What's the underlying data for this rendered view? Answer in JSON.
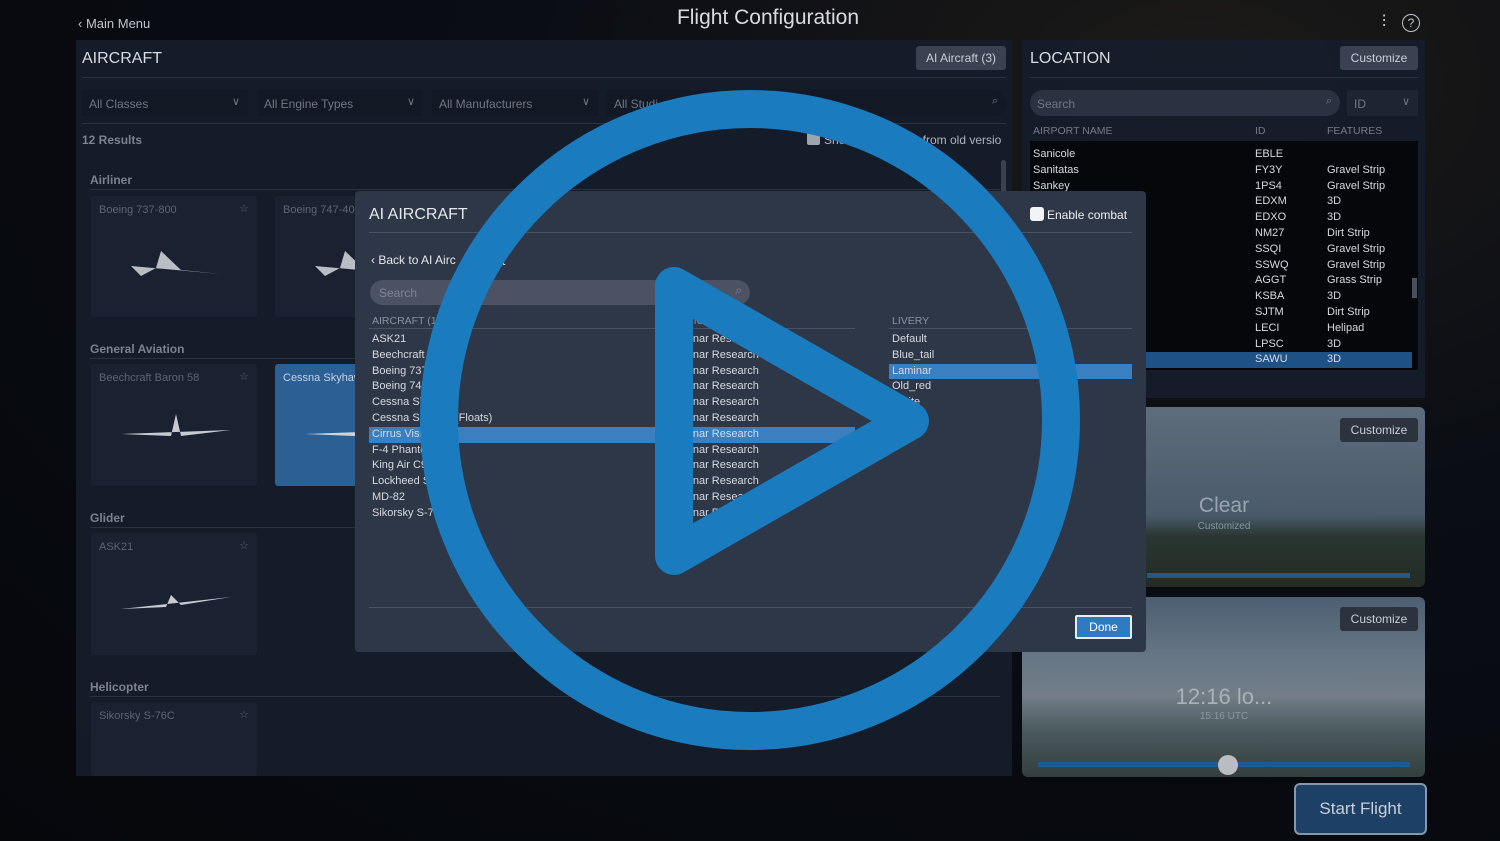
{
  "header": {
    "title": "Flight Configuration",
    "back_label": "Main Menu",
    "icons": [
      "sliders-icon",
      "help-icon"
    ]
  },
  "aircraft": {
    "title": "AIRCRAFT",
    "ai_button": "AI Aircraft (3)",
    "filters": [
      "All Classes",
      "All Engine Types",
      "All Manufacturers",
      "All Studi"
    ],
    "results": "12 Results",
    "show_old_label": "Show",
    "show_old_suffix": "t from old versio",
    "sections": [
      {
        "label": "Airliner",
        "cards": [
          "Boeing 737-800",
          "Boeing 747-400"
        ]
      },
      {
        "label": "General Aviation",
        "cards": [
          "Beechcraft Baron 58",
          "Cessna Skyhaw"
        ]
      },
      {
        "label": "Glider",
        "cards": [
          "ASK21"
        ]
      },
      {
        "label": "Helicopter",
        "cards": [
          "Sikorsky S-76C"
        ]
      }
    ]
  },
  "location": {
    "title": "LOCATION",
    "customize": "Customize",
    "search_placeholder": "Search",
    "id_select": "ID",
    "columns": [
      "AIRPORT NAME",
      "ID",
      "FEATURES"
    ],
    "rows": [
      [
        "Sanicole",
        "EBLE",
        ""
      ],
      [
        "Sanitatas",
        "FY3Y",
        "Gravel Strip"
      ],
      [
        "Sankey",
        "1PS4",
        "Gravel Strip"
      ],
      [
        "",
        "EDXM",
        "3D"
      ],
      [
        "",
        "EDXO",
        "3D"
      ],
      [
        "",
        "NM27",
        "Dirt Strip"
      ],
      [
        "",
        "SSQI",
        "Gravel Strip"
      ],
      [
        "",
        "SSWQ",
        "Gravel Strip"
      ],
      [
        "",
        "AGGT",
        "Grass Strip"
      ],
      [
        "",
        "KSBA",
        "3D"
      ],
      [
        "",
        "SJTM",
        "Dirt Strip"
      ],
      [
        "",
        "LECI",
        "Helipad"
      ],
      [
        "",
        "LPSC",
        "3D"
      ],
      [
        "",
        "SAWU",
        "3D"
      ]
    ],
    "selected_id": "SAWU"
  },
  "weather": {
    "customize": "Customize",
    "label": "Clear",
    "sub": "Customized"
  },
  "time": {
    "customize": "Customize",
    "label": "12:16 lo...",
    "sub": "15:16 UTC",
    "slider_fraction": 0.51
  },
  "start_flight": "Start Flight",
  "modal": {
    "title": "AI AIRCRAFT",
    "enable_combat": "Enable combat",
    "back": "Back to AI Airc",
    "back_suffix": "st",
    "search_placeholder": "Search",
    "col_aircraft": "AIRCRAFT (12",
    "col_studio": "DIO",
    "col_livery": "LIVERY",
    "aircraft": [
      "ASK21",
      "Beechcraft",
      "Boeing 737",
      "Boeing 747",
      "Cessna Sk",
      "Cessna Sk",
      "Cirrus Visi",
      "F-4 Phanto",
      "King Air C9",
      "Lockheed S",
      "MD-82",
      "Sikorsky S-76"
    ],
    "aircraft_suffix": {
      "1": "8",
      "5": "(Floats)",
      "6": ")"
    },
    "studios": [
      "Laminar Research",
      "Laminar Research",
      "Laminar Research",
      "Laminar Research",
      "Laminar Research",
      "Laminar Research",
      "Laminar Research",
      "Laminar Research",
      "Laminar Research",
      "Laminar Research",
      "Laminar Research",
      "Laminar Research"
    ],
    "selected_aircraft": 6,
    "liveries": [
      "Default",
      "Blue_tail",
      "Laminar",
      "Old_red",
      "White"
    ],
    "selected_livery": 2,
    "done": "Done"
  },
  "overlay": {
    "icon": "play-video-icon",
    "color": "#1a7bbf"
  }
}
